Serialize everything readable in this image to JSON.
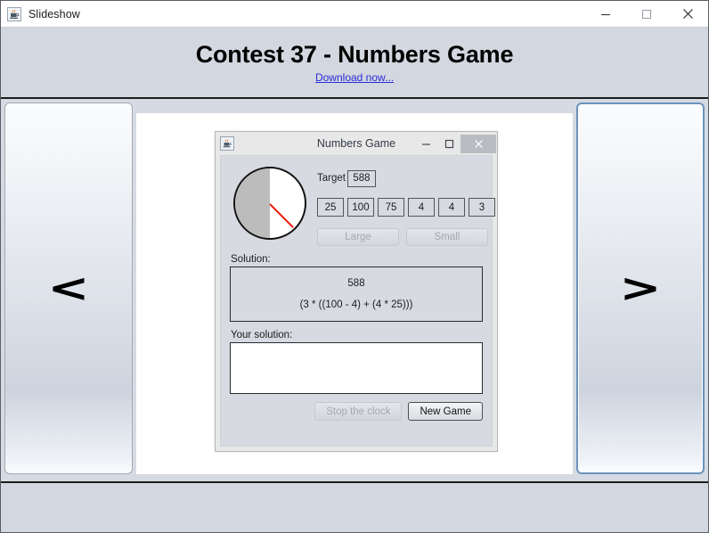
{
  "window": {
    "title": "Slideshow",
    "icon": "java-icon",
    "controls": {
      "minimize": "minimize-icon",
      "maximize": "maximize-icon",
      "close": "close-icon"
    }
  },
  "header": {
    "title": "Contest 37 - Numbers Game",
    "link_label": "Download now...",
    "link_color": "#2b2bd8"
  },
  "nav": {
    "previous_label": "<",
    "next_label": ">",
    "focus_color": "#6b93bd"
  },
  "inner_window": {
    "title": "Numbers Game",
    "icon": "java-icon",
    "controls": {
      "minimize": "minimize-icon",
      "maximize": "maximize-icon",
      "close": "close-icon"
    },
    "clock": {
      "elapsed_fill_color": "#bcbcbc",
      "hand_color": "#ea1c0f",
      "hand_angle_deg": 45
    },
    "target": {
      "label": "Target",
      "value": "588"
    },
    "numbers": [
      "25",
      "100",
      "75",
      "4",
      "4",
      "3"
    ],
    "size_buttons": [
      {
        "label": "Large",
        "enabled": false
      },
      {
        "label": "Small",
        "enabled": false
      }
    ],
    "solution": {
      "label": "Solution:",
      "total": "588",
      "expression": "(3 * ((100 - 4) + (4 * 25)))"
    },
    "user_solution": {
      "label": "Your solution:",
      "value": "",
      "placeholder": ""
    },
    "actions": [
      {
        "label": "Stop the clock",
        "enabled": false
      },
      {
        "label": "New Game",
        "enabled": true
      }
    ]
  },
  "footer": {
    "status_text": ""
  }
}
